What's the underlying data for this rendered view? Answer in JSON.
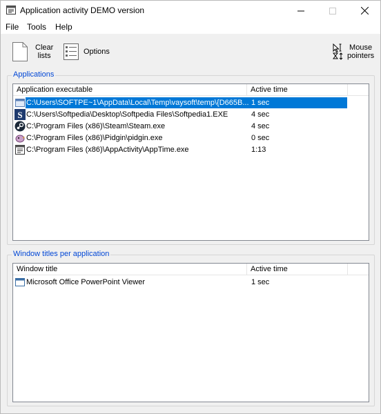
{
  "window": {
    "title": "Application activity DEMO version"
  },
  "menu": {
    "items": [
      "File",
      "Tools",
      "Help"
    ]
  },
  "toolbar": {
    "clear_lists_line1": "Clear",
    "clear_lists_line2": "lists",
    "options_label": "Options",
    "mouse_pointers_line1": "Mouse",
    "mouse_pointers_line2": "pointers"
  },
  "applications": {
    "legend": "Applications",
    "columns": [
      "Application executable",
      "Active time"
    ],
    "rows": [
      {
        "path": "C:\\Users\\SOFTPE~1\\AppData\\Local\\Temp\\vaysoft\\temp\\{D665B...",
        "time": "1 sec",
        "icon": "generic-app-icon",
        "selected": true
      },
      {
        "path": "C:\\Users\\Softpedia\\Desktop\\Softpedia Files\\Softpedia1.EXE",
        "time": "4 sec",
        "icon": "softpedia-icon",
        "selected": false
      },
      {
        "path": "C:\\Program Files (x86)\\Steam\\Steam.exe",
        "time": "4 sec",
        "icon": "steam-icon",
        "selected": false
      },
      {
        "path": "C:\\Program Files (x86)\\Pidgin\\pidgin.exe",
        "time": "0 sec",
        "icon": "pidgin-icon",
        "selected": false
      },
      {
        "path": "C:\\Program Files (x86)\\AppActivity\\AppTime.exe",
        "time": "1:13",
        "icon": "apptime-icon",
        "selected": false
      }
    ]
  },
  "window_titles": {
    "legend": "Window titles per application",
    "columns": [
      "Window title",
      "Active time"
    ],
    "rows": [
      {
        "title": "Microsoft Office PowerPoint Viewer",
        "time": "1 sec",
        "icon": "window-icon"
      }
    ]
  },
  "colors": {
    "selection": "#0078d7",
    "legend_text": "#0046d5"
  }
}
